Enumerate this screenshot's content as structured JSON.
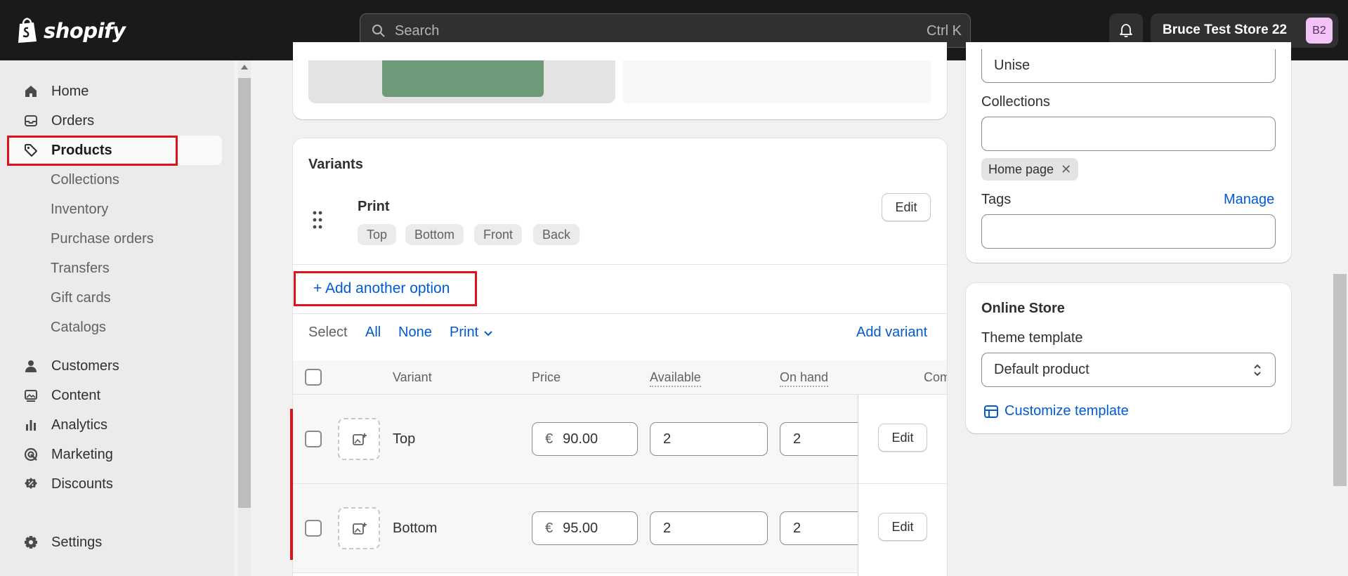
{
  "topbar": {
    "brand": "shopify",
    "search_placeholder": "Search",
    "search_shortcut": "Ctrl K",
    "store_name": "Bruce Test Store 22",
    "store_initials": "B2"
  },
  "sidebar": {
    "items": [
      {
        "label": "Home",
        "icon": "home-icon"
      },
      {
        "label": "Orders",
        "icon": "inbox-icon"
      },
      {
        "label": "Products",
        "icon": "tag-icon",
        "active": true
      },
      {
        "label": "Customers",
        "icon": "person-icon"
      },
      {
        "label": "Content",
        "icon": "image-icon"
      },
      {
        "label": "Analytics",
        "icon": "bar-chart-icon"
      },
      {
        "label": "Marketing",
        "icon": "target-icon"
      },
      {
        "label": "Discounts",
        "icon": "discount-icon"
      },
      {
        "label": "Settings",
        "icon": "gear-icon"
      }
    ],
    "product_subitems": [
      "Collections",
      "Inventory",
      "Purchase orders",
      "Transfers",
      "Gift cards",
      "Catalogs"
    ]
  },
  "variants": {
    "title": "Variants",
    "option_name": "Print",
    "option_values": [
      "Top",
      "Bottom",
      "Front",
      "Back"
    ],
    "edit_label": "Edit",
    "add_option_label": "+ Add another option",
    "select_label": "Select",
    "select_all": "All",
    "select_none": "None",
    "select_by": "Print",
    "add_variant": "Add variant",
    "columns": [
      "Variant",
      "Price",
      "Available",
      "On hand",
      "Com"
    ],
    "rows": [
      {
        "name": "Top",
        "currency": "€",
        "price": "90.00",
        "available": "2",
        "on_hand": "2",
        "edit": "Edit"
      },
      {
        "name": "Bottom",
        "currency": "€",
        "price": "95.00",
        "available": "2",
        "on_hand": "2",
        "edit": "Edit"
      }
    ]
  },
  "organization": {
    "type_value": "Unise",
    "collections_label": "Collections",
    "collections_value": "",
    "collection_chip": "Home page",
    "tags_label": "Tags",
    "tags_manage": "Manage",
    "tags_value": ""
  },
  "online_store": {
    "title": "Online Store",
    "theme_template_label": "Theme template",
    "theme_template_value": "Default product",
    "customize_label": "Customize template"
  },
  "colors": {
    "topbar": "#1a1a1a",
    "link": "#005bd3",
    "highlight": "#e0101c",
    "avatar": "#f2c3f6"
  }
}
